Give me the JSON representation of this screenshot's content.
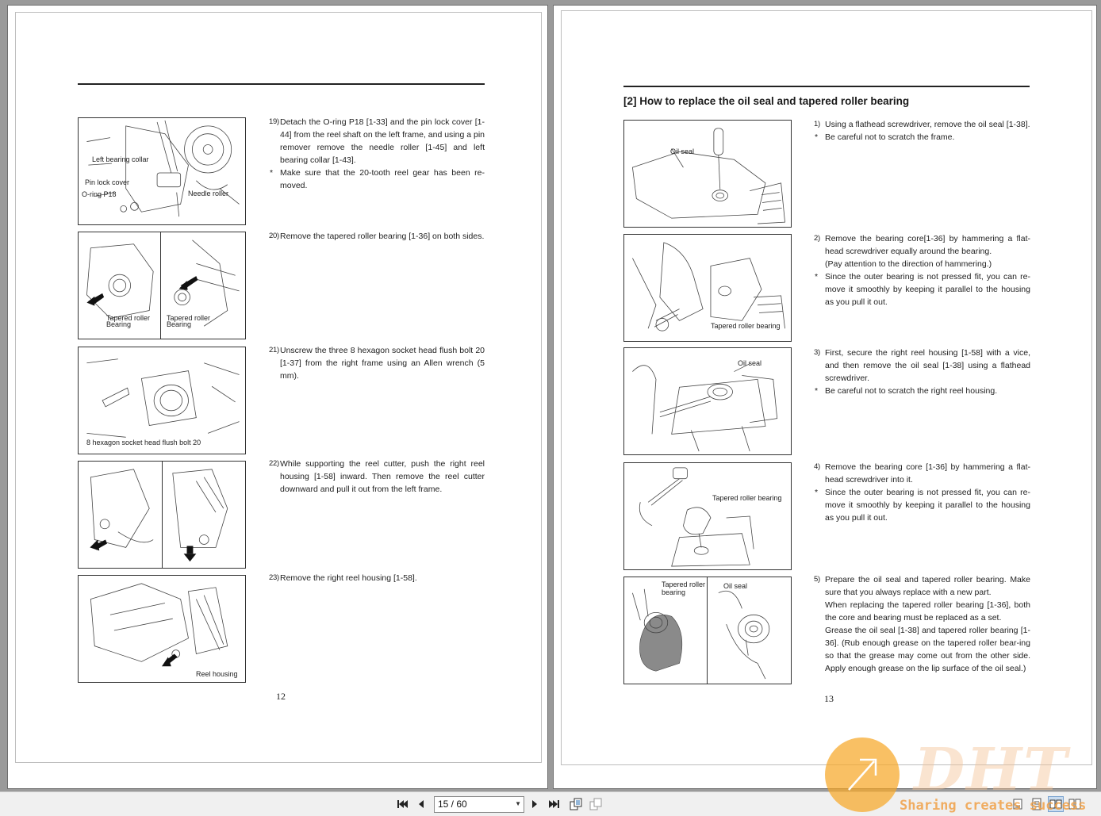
{
  "left_page": {
    "page_number": "12",
    "steps": [
      {
        "num": "19)",
        "text": "Detach the O-ring P18  [1-33] and the pin lock cover [1-44] from the reel shaft on the left frame, and using a pin remover remove the needle roller [1-45] and left bearing collar [1-43].",
        "note": "Make sure that the 20-tooth reel gear has been re-moved."
      },
      {
        "num": "20)",
        "text": "Remove the tapered roller bearing [1-36] on both sides."
      },
      {
        "num": "21)",
        "text": "Unscrew the three 8 hexagon socket head flush bolt 20 [1-37] from the right frame using an Allen wrench (5 mm)."
      },
      {
        "num": "22)",
        "text": "While supporting the reel cutter, push the right reel housing [1-58] inward. Then remove the reel cutter downward and pull it out from the left frame."
      },
      {
        "num": "23)",
        "text": "Remove the right reel housing [1-58]."
      }
    ],
    "fig_labels": {
      "fig1_a": "Left bearing collar",
      "fig1_b": "Pin lock cover",
      "fig1_c": "O-ring P18",
      "fig1_d": "Needle roller",
      "fig2_a": "Tapered roller",
      "fig2_b": "Bearing",
      "fig2_c": "Tapered roller",
      "fig2_d": "Bearing",
      "fig3_a": "8 hexagon socket head flush bolt 20",
      "fig5_a": "Reel housing"
    }
  },
  "right_page": {
    "page_number": "13",
    "section_title": "[2] How to replace the oil seal and tapered roller bearing",
    "steps": [
      {
        "num": "1)",
        "text": "Using a flathead screwdriver, remove the oil seal [1-38].",
        "note": "Be careful not to scratch the frame."
      },
      {
        "num": "2)",
        "text": "Remove the bearing core[1-36] by hammering a flat-head screwdriver equally around the bearing.",
        "text2": "(Pay attention to the direction of hammering.)",
        "note": "Since the outer bearing is not pressed fit, you can re-move it smoothly by keeping it parallel to the housing as you pull it out."
      },
      {
        "num": "3)",
        "text": "First, secure the right reel housing [1-58] with a vice, and then remove the oil seal [1-38] using a flathead screwdriver.",
        "note": "Be careful not to scratch the right reel housing."
      },
      {
        "num": "4)",
        "text": "Remove the bearing core [1-36] by hammering a flat-head screwdriver into it.",
        "note": "Since the outer bearing is not pressed fit, you can re-move it smoothly by keeping it parallel to the housing as you pull it out."
      },
      {
        "num": "5)",
        "text": "Prepare the oil seal and tapered roller bearing. Make sure that you always replace with a new part.",
        "text2": "When replacing the tapered roller bearing [1-36], both the core and  bearing must be replaced as a set.",
        "text3": "Grease the oil seal [1-38] and tapered roller bearing [1-36]. (Rub enough grease on the tapered roller bear-ing so that the grease may come out from the other side. Apply enough grease on the lip surface of the oil seal.)"
      }
    ],
    "fig_labels": {
      "fig1_a": "Oil seal",
      "fig2_a": "Tapered roller bearing",
      "fig3_a": "Oil seal",
      "fig4_a": "Tapered roller bearing",
      "fig5_a": "Tapered roller",
      "fig5_b": "bearing",
      "fig5_c": "Oil seal"
    }
  },
  "note_marker": "*",
  "toolbar": {
    "page_indicator": "15 / 60",
    "icons": [
      "first-page-icon",
      "prev-page-icon",
      "next-page-icon",
      "last-page-icon",
      "fit-page-icon",
      "fit-width-icon",
      "single-page-icon",
      "continuous-icon",
      "two-page-icon",
      "two-page-continuous-icon"
    ]
  },
  "watermark": {
    "brand": "DHT",
    "slogan": "Sharing creates success"
  },
  "colors": {
    "watermark_orange": "#f7a828",
    "background": "#9a9a9a",
    "toolbar": "#f0f0f0"
  }
}
